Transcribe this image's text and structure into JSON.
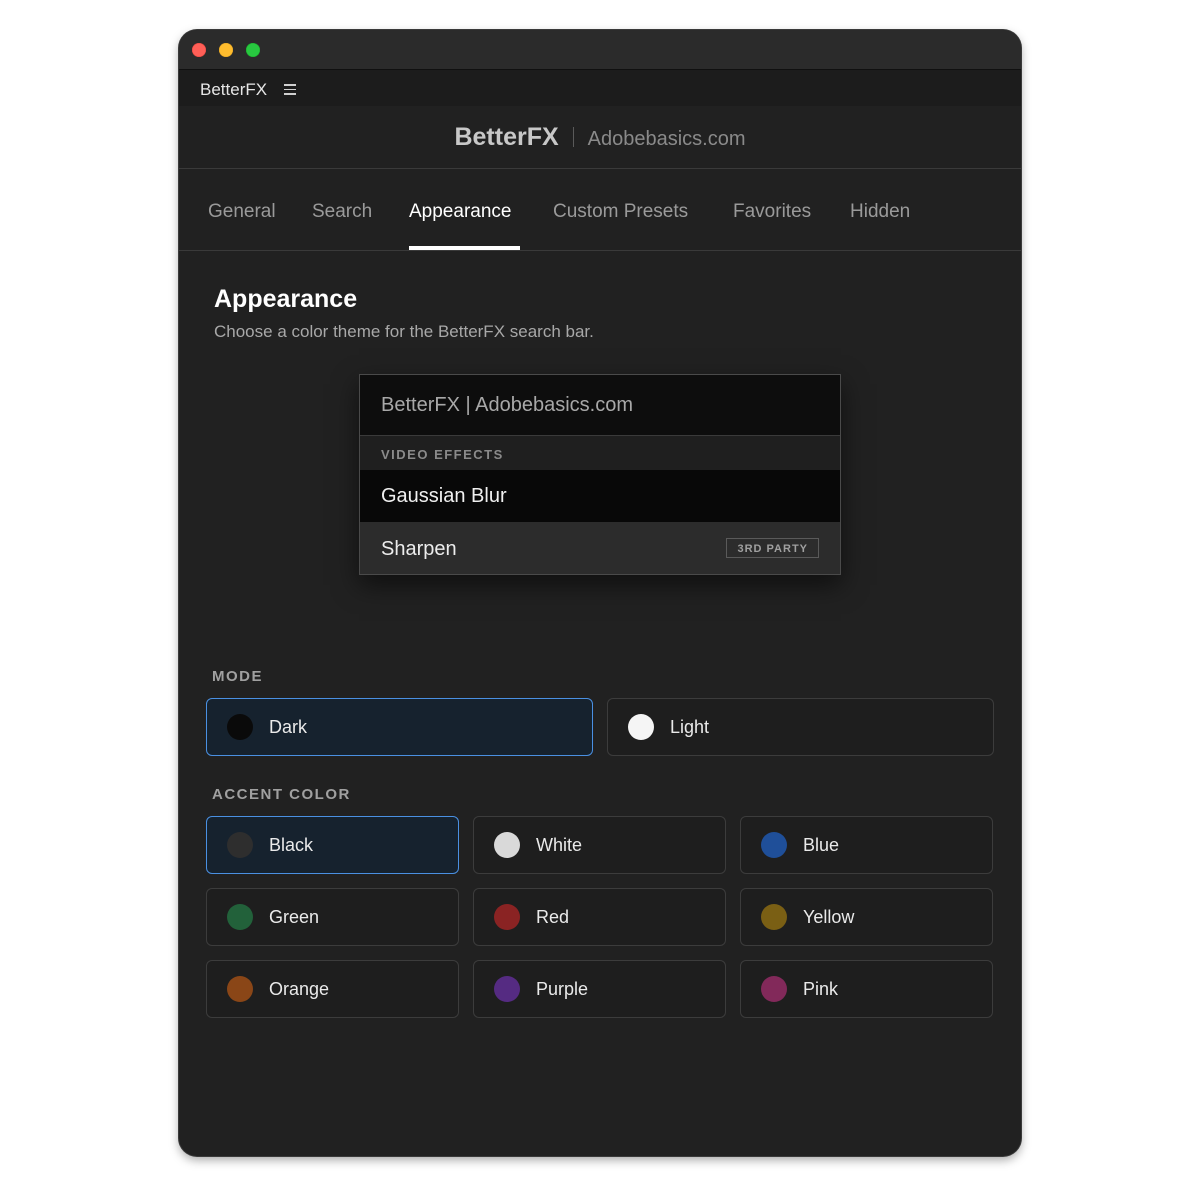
{
  "menubar": {
    "app_name": "BetterFX"
  },
  "header": {
    "brand": "BetterFX",
    "site": "Adobebasics.com"
  },
  "tabs": [
    {
      "label": "General"
    },
    {
      "label": "Search"
    },
    {
      "label": "Appearance"
    },
    {
      "label": "Custom Presets"
    },
    {
      "label": "Favorites"
    },
    {
      "label": "Hidden"
    }
  ],
  "active_tab": "Appearance",
  "section": {
    "title": "Appearance",
    "subtitle": "Choose a color theme for the BetterFX search bar."
  },
  "preview": {
    "search_text": "BetterFX | Adobebasics.com",
    "category": "VIDEO EFFECTS",
    "items": [
      {
        "name": "Gaussian Blur",
        "badge": ""
      },
      {
        "name": "Sharpen",
        "badge": "3RD PARTY"
      }
    ]
  },
  "mode": {
    "label": "MODE",
    "selected": "Dark",
    "options": [
      {
        "label": "Dark",
        "color": "#0a0a0a"
      },
      {
        "label": "Light",
        "color": "#f5f5f5"
      }
    ]
  },
  "accent": {
    "label": "ACCENT COLOR",
    "selected": "Black",
    "options": [
      {
        "label": "Black",
        "color": "#2e2e2e"
      },
      {
        "label": "White",
        "color": "#d9d9d9"
      },
      {
        "label": "Blue",
        "color": "#1f4f99"
      },
      {
        "label": "Green",
        "color": "#22613a"
      },
      {
        "label": "Red",
        "color": "#8a2323"
      },
      {
        "label": "Yellow",
        "color": "#7a5f14"
      },
      {
        "label": "Orange",
        "color": "#8a4617"
      },
      {
        "label": "Purple",
        "color": "#552b82"
      },
      {
        "label": "Pink",
        "color": "#82295a"
      }
    ]
  }
}
